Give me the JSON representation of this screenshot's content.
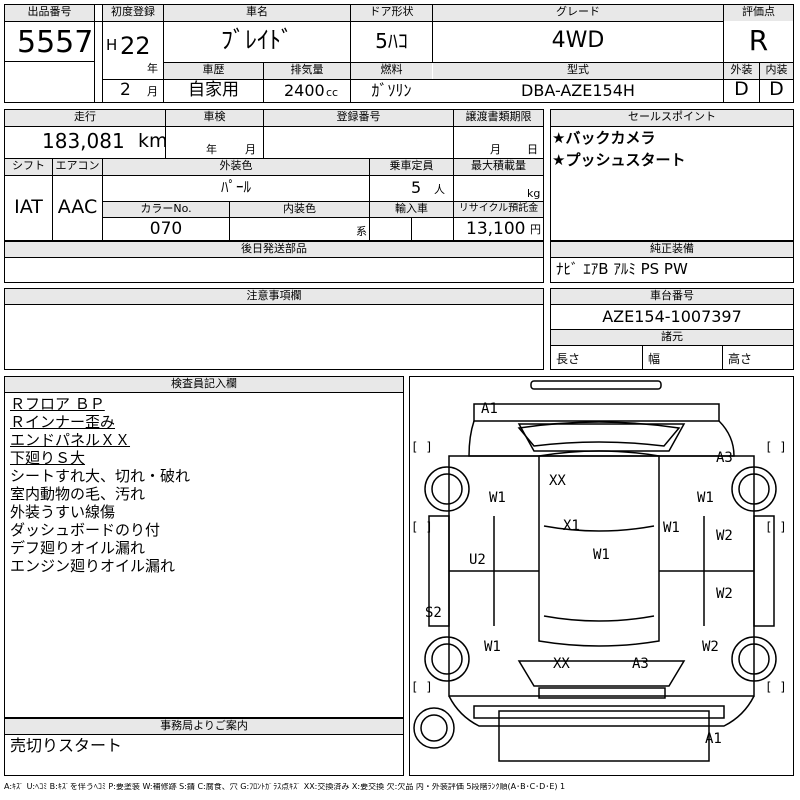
{
  "header": {
    "lot_label": "出品番号",
    "lot_number": "5557",
    "first_reg_label": "初度登録",
    "era": "H",
    "reg_year": "22",
    "year_unit": "年",
    "reg_month": "2",
    "month_unit": "月",
    "car_name_label": "車名",
    "car_name": "ﾌﾞﾚｲﾄﾞ",
    "door_label": "ドア形状",
    "door_type": "5ﾊｺ",
    "grade_label": "グレード",
    "grade": "4WD",
    "score_label": "評価点",
    "score": "R",
    "history_label": "車歴",
    "history": "自家用",
    "displacement_label": "排気量",
    "displacement": "2400",
    "displacement_unit": "cc",
    "fuel_label": "燃料",
    "fuel": "ｶﾞｿﾘﾝ",
    "model_label": "型式",
    "model": "DBA-AZE154H",
    "exterior_label": "外装",
    "exterior_grade": "D",
    "interior_label": "内装",
    "interior_grade": "D"
  },
  "specs": {
    "mileage_label": "走行",
    "mileage": "183,081",
    "mileage_unit": "km",
    "inspection_label": "車検",
    "inspection_year_unit": "年",
    "inspection_month_unit": "月",
    "reg_no_label": "登録番号",
    "transfer_label": "譲渡書類期限",
    "transfer_month_unit": "月",
    "transfer_day_unit": "日",
    "shift_label": "シフト",
    "shift": "IAT",
    "ac_label": "エアコン",
    "ac": "AAC",
    "ext_color_label": "外装色",
    "ext_color": "ﾊﾟｰﾙ",
    "capacity_label": "乗車定員",
    "capacity": "5",
    "capacity_unit": "人",
    "load_label": "最大積載量",
    "load_unit": "kg",
    "color_no_label": "カラーNo.",
    "color_no": "070",
    "int_color_label": "内装色",
    "int_color_unit": "系",
    "import_label": "輸入車",
    "recycle_label": "リサイクル預託金",
    "recycle": "13,100",
    "recycle_unit": "円"
  },
  "sales_points": {
    "label": "セールスポイント",
    "items": [
      "★バックカメラ",
      "★プッシュスタート"
    ]
  },
  "later_parts": {
    "label": "後日発送部品"
  },
  "equipment": {
    "label": "純正装備",
    "value": "ﾅﾋﾞ ｴｱB ｱﾙﾐ PS PW"
  },
  "notes": {
    "label": "注意事項欄"
  },
  "chassis": {
    "label": "車台番号",
    "value": "AZE154-1007397"
  },
  "dimensions": {
    "label": "諸元",
    "length": "長さ",
    "width": "幅",
    "height": "高さ"
  },
  "inspector": {
    "label": "検査員記入欄",
    "lines": [
      "Ｒフロア ＢＰ",
      "Ｒインナー歪み",
      "エンドパネルＸＸ",
      "下廻りＳ大",
      "シートすれ大、切れ・破れ",
      "室内動物の毛、汚れ",
      "外装うすい線傷",
      "ダッシュボードのり付",
      "デフ廻りオイル漏れ",
      "エンジン廻りオイル漏れ"
    ]
  },
  "office": {
    "label": "事務局よりご案内",
    "text": "売切りスタート"
  },
  "diagram": {
    "marks": [
      "A1",
      "A3",
      "W1",
      "W1",
      "XX",
      "X1",
      "W1",
      "W2",
      "U2",
      "W1",
      "W2",
      "S2",
      "W1",
      "W2",
      "XX",
      "A3",
      "A1"
    ],
    "brackets": [
      "[  ]",
      "[  ]",
      "[  ]",
      "[  ]",
      "[  ]",
      "[  ]"
    ]
  },
  "legend": "A:ｷｽﾞ U:ﾍｺﾐ B:ｷｽﾞを伴うﾍｺﾐ P:要塗装 W:補修跡 S:錆 C:腐食、穴 G:ﾌﾛﾝﾄｶﾞﾗｽ点ｷｽﾞ XX:交換済み X:要交換 欠:欠品 内・外装評価 5段階ﾗﾝｸ順(A･B･C･D･E) 1"
}
